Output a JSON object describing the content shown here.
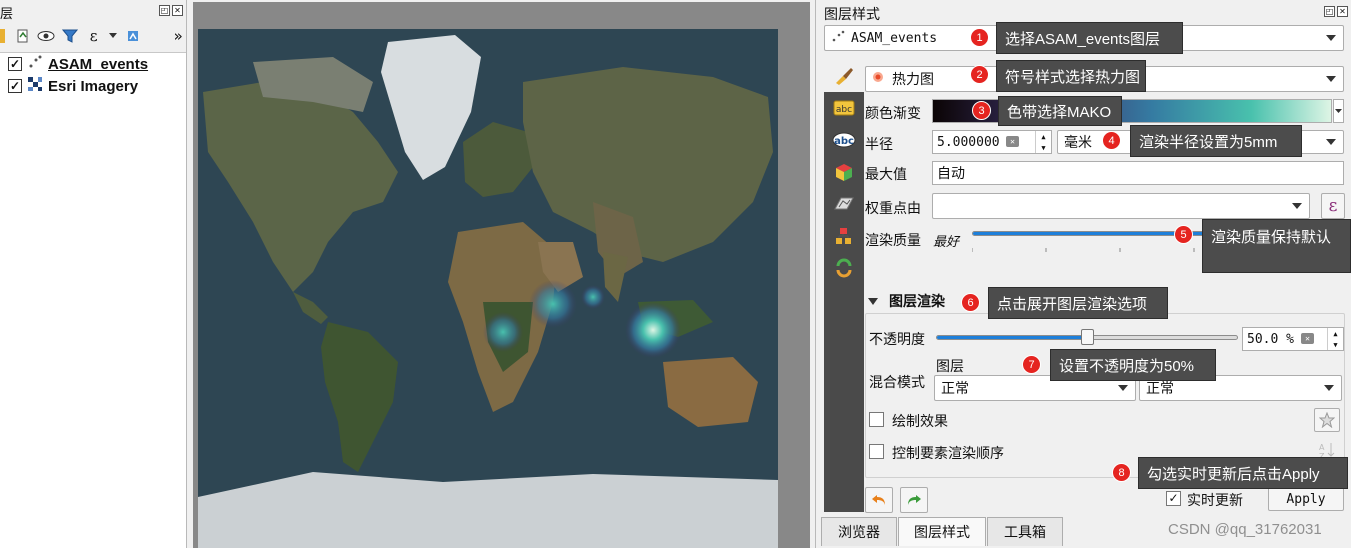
{
  "layers_panel": {
    "title": "层",
    "toolbar_icons": [
      "paint-icon",
      "open-layer-icon",
      "eye-icon",
      "filter-icon",
      "expression-icon",
      "dropdown-icon",
      "remove-icon"
    ],
    "more": "»",
    "layers": [
      {
        "name": "ASAM_events",
        "checked": "✓",
        "icon": "point-layer-icon",
        "selected": true
      },
      {
        "name": "Esri Imagery",
        "checked": "✓",
        "icon": "raster-layer-icon",
        "selected": false
      }
    ]
  },
  "style_panel": {
    "title": "图层样式",
    "layer_select": "ASAM_events",
    "renderer_select": "热力图",
    "color_ramp_label": "颜色渐变",
    "radius_label": "半径",
    "radius_value": "5.000000",
    "radius_unit": "毫米",
    "max_label": "最大值",
    "max_value": "自动",
    "weight_label": "权重点由",
    "weight_value": "",
    "quality_label": "渲染质量",
    "quality_value": "最好",
    "quality_level": 0.72,
    "layer_render_section": "图层渲染",
    "opacity_label": "不透明度",
    "opacity_value": "50.0 %",
    "opacity_level": 0.5,
    "blend_label": "混合模式",
    "blend_layer_label": "图层",
    "blend_layer_value": "正常",
    "blend_feature_value": "正常",
    "draw_effects_label": "绘制效果",
    "control_order_label": "控制要素渲染顺序",
    "live_update_label": "实时更新",
    "live_update_check": "✓",
    "apply_label": "Apply",
    "expression_symbol": "ε",
    "colors": {
      "ramp_start": "#0b0405",
      "ramp_mid1": "#3e356b",
      "ramp_mid2": "#357ba2",
      "ramp_mid3": "#49c1ad",
      "ramp_end": "#def5e5",
      "slider_fill": "#1e7fd9"
    }
  },
  "annotations": [
    {
      "num": "1",
      "text": "选择ASAM_events图层"
    },
    {
      "num": "2",
      "text": "符号样式选择热力图"
    },
    {
      "num": "3",
      "text": "色带选择MAKO"
    },
    {
      "num": "4",
      "text": "渲染半径设置为5mm"
    },
    {
      "num": "5",
      "text": "渲染质量保持默认"
    },
    {
      "num": "6",
      "text": "点击展开图层渲染选项"
    },
    {
      "num": "7",
      "text": "设置不透明度为50%"
    },
    {
      "num": "8",
      "text": "勾选实时更新后点击Apply"
    }
  ],
  "bottom_tabs": [
    "浏览器",
    "图层样式",
    "工具箱"
  ],
  "watermark": "CSDN @qq_31762031"
}
